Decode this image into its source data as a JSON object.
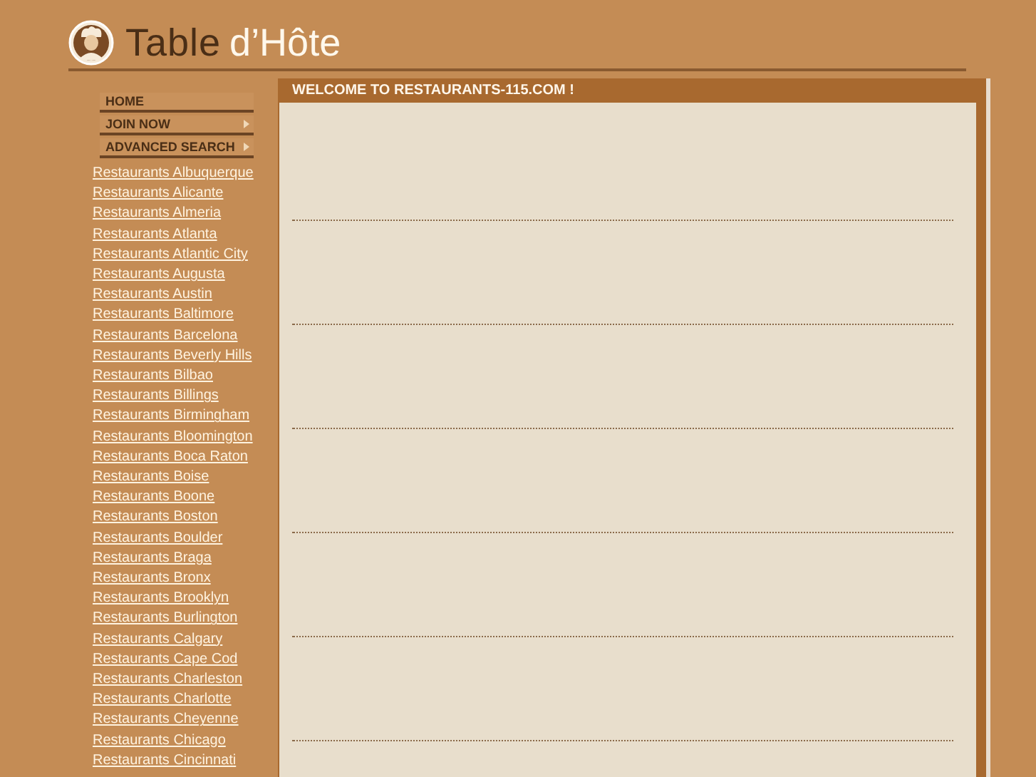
{
  "logo": {
    "title": "Table",
    "subtitle": "d’Hôte"
  },
  "nav": [
    {
      "label": "HOME",
      "has_submenu": false
    },
    {
      "label": "JOIN NOW",
      "has_submenu": true
    },
    {
      "label": "ADVANCED SEARCH",
      "has_submenu": true
    }
  ],
  "links": [
    "Restaurants Albuquerque",
    "Restaurants Alicante",
    "Restaurants Almeria",
    "Restaurants Atlanta",
    "Restaurants Atlantic City",
    "Restaurants Augusta",
    "Restaurants Austin",
    "Restaurants Baltimore",
    "Restaurants Barcelona",
    "Restaurants Beverly Hills",
    "Restaurants Bilbao",
    "Restaurants Billings",
    "Restaurants Birmingham",
    "Restaurants Bloomington",
    "Restaurants Boca Raton",
    "Restaurants Boise",
    "Restaurants Boone",
    "Restaurants Boston",
    "Restaurants Boulder",
    "Restaurants Braga",
    "Restaurants Bronx",
    "Restaurants Brooklyn",
    "Restaurants Burlington",
    "Restaurants Calgary",
    "Restaurants Cape Cod",
    "Restaurants Charleston",
    "Restaurants Charlotte",
    "Restaurants Cheyenne",
    "Restaurants Chicago",
    "Restaurants Cincinnati"
  ],
  "panel": {
    "title": "WELCOME TO RESTAURANTS-115.COM !"
  }
}
